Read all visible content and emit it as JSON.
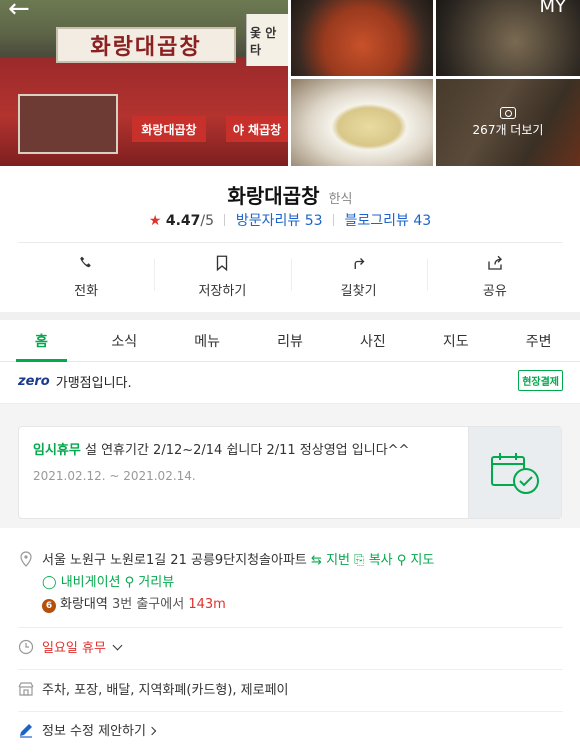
{
  "header": {
    "back_icon": "arrow-left-icon",
    "my_label": "MY"
  },
  "photos": {
    "storefront_sign": "화랑대곱창",
    "storefront_side_sign": "옻 안타",
    "awning_left": "화랑대곱창",
    "awning_right": "야 채곱창",
    "more_count_label": "267개 더보기"
  },
  "place": {
    "name": "화랑대곱창",
    "category": "한식",
    "rating": "4.47",
    "rating_max": "/5",
    "visitor_review_label": "방문자리뷰",
    "visitor_review_count": "53",
    "blog_review_label": "블로그리뷰",
    "blog_review_count": "43"
  },
  "actions": [
    {
      "label": "전화",
      "icon": "phone-icon"
    },
    {
      "label": "저장하기",
      "icon": "bookmark-icon"
    },
    {
      "label": "길찾기",
      "icon": "directions-icon"
    },
    {
      "label": "공유",
      "icon": "share-icon"
    }
  ],
  "tabs": [
    "홈",
    "소식",
    "메뉴",
    "리뷰",
    "사진",
    "지도",
    "주변"
  ],
  "active_tab": "홈",
  "zeropay": {
    "logo": "zero",
    "text": "가맹점입니다.",
    "badge": "현장결제"
  },
  "notice": {
    "label": "임시휴무",
    "text": "설 연휴기간 2/12~2/14 쉽니다 2/11 정상영업 입니다^^",
    "date_range": "2021.02.12. ~ 2021.02.14.",
    "icon": "calendar-check-icon"
  },
  "address": {
    "text": "서울 노원구 노원로1길 21 공릉9단지청솔아파트",
    "jibun_label": "지번",
    "copy_label": "복사",
    "map_label": "지도",
    "navigation_label": "내비게이션",
    "streetview_label": "거리뷰",
    "station_line": "6",
    "station_name": "화랑대역",
    "station_exit": "3번 출구에서",
    "station_distance": "143m"
  },
  "hours": {
    "text": "일요일 휴무"
  },
  "facilities": {
    "text": "주차, 포장, 배달, 지역화폐(카드형), 제로페이"
  },
  "suggest": {
    "text": "정보 수정 제안하기"
  },
  "colors": {
    "accent_green": "#03a94d",
    "star_red": "#e0322f",
    "link_blue": "#1e64c8"
  }
}
